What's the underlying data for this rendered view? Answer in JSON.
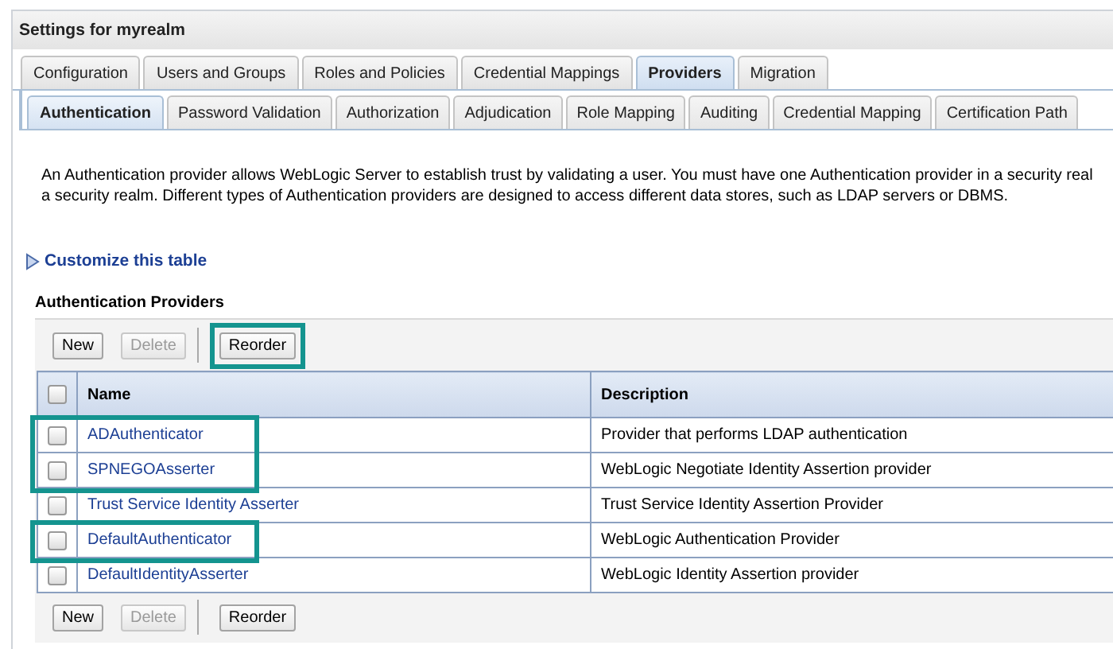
{
  "panel": {
    "title": "Settings for myrealm"
  },
  "tabs": [
    {
      "label": "Configuration",
      "selected": false
    },
    {
      "label": "Users and Groups",
      "selected": false
    },
    {
      "label": "Roles and Policies",
      "selected": false
    },
    {
      "label": "Credential Mappings",
      "selected": false
    },
    {
      "label": "Providers",
      "selected": true
    },
    {
      "label": "Migration",
      "selected": false
    }
  ],
  "subtabs": [
    {
      "label": "Authentication",
      "selected": true
    },
    {
      "label": "Password Validation",
      "selected": false
    },
    {
      "label": "Authorization",
      "selected": false
    },
    {
      "label": "Adjudication",
      "selected": false
    },
    {
      "label": "Role Mapping",
      "selected": false
    },
    {
      "label": "Auditing",
      "selected": false
    },
    {
      "label": "Credential Mapping",
      "selected": false
    },
    {
      "label": "Certification Path",
      "selected": false
    }
  ],
  "intro_lines": [
    "An Authentication provider allows WebLogic Server to establish trust by validating a user. You must have one Authentication provider in a security real",
    "a security realm. Different types of Authentication providers are designed to access different data stores, such as LDAP servers or DBMS."
  ],
  "customize_link": "Customize this table",
  "table_title": "Authentication Providers",
  "top_buttons": [
    {
      "label": "New",
      "disabled": false,
      "highlighted": false
    },
    {
      "label": "Delete",
      "disabled": true,
      "highlighted": false
    },
    {
      "label": "Reorder",
      "disabled": false,
      "highlighted": true
    }
  ],
  "select_all_checked": false,
  "columns": [
    "Name",
    "Description"
  ],
  "rows": [
    {
      "name": "ADAuthenticator",
      "description": "Provider that performs LDAP authentication",
      "checked": false,
      "highlighted": true
    },
    {
      "name": "SPNEGOAsserter",
      "description": "WebLogic Negotiate Identity Assertion provider",
      "checked": false,
      "highlighted": true
    },
    {
      "name": "Trust Service Identity Asserter",
      "description": "Trust Service Identity Assertion Provider",
      "checked": false,
      "highlighted": false
    },
    {
      "name": "DefaultAuthenticator",
      "description": "WebLogic Authentication Provider",
      "checked": false,
      "highlighted": true
    },
    {
      "name": "DefaultIdentityAsserter",
      "description": "WebLogic Identity Assertion provider",
      "checked": false,
      "highlighted": false
    }
  ],
  "bottom_buttons": [
    {
      "label": "New",
      "disabled": false,
      "highlighted": false
    },
    {
      "label": "Delete",
      "disabled": true,
      "highlighted": false
    },
    {
      "label": "Reorder",
      "disabled": false,
      "highlighted": false
    }
  ]
}
